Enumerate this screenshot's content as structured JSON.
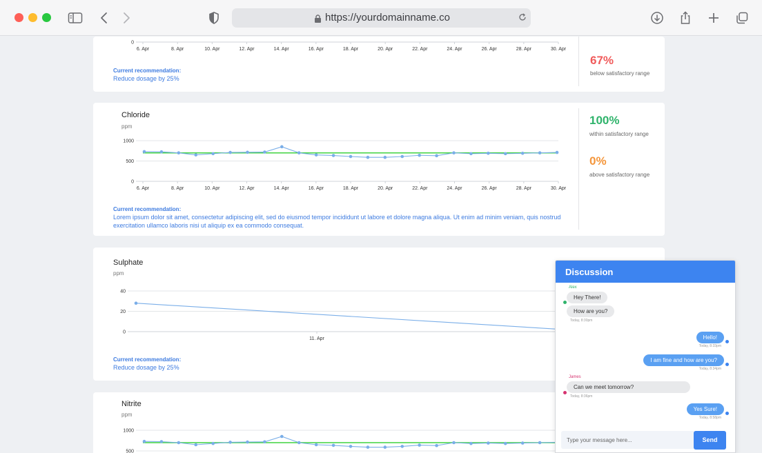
{
  "browser": {
    "url": "https://yourdomainname.co"
  },
  "charts": [
    {
      "id": "top",
      "title": "",
      "unit": "",
      "recommendation_label": "Current recommendation:",
      "recommendation": "Reduce dosage by 25%",
      "stats": [
        {
          "value": "67%",
          "label": "below satisfactory range",
          "color": "#f05a5a"
        }
      ]
    },
    {
      "id": "chloride",
      "title": "Chloride",
      "unit": "ppm",
      "recommendation_label": "Current recommendation:",
      "recommendation": "Lorem ipsum dolor sit amet, consectetur adipiscing elit, sed do eiusmod tempor incididunt ut labore et dolore magna aliqua. Ut enim ad minim veniam, quis nostrud exercitation ullamco laboris nisi ut aliquip ex ea commodo consequat.",
      "stats": [
        {
          "value": "100%",
          "label": "within satisfactory range",
          "color": "#2fb36b"
        },
        {
          "value": "0%",
          "label": "above satisfactory range",
          "color": "#f4963b"
        }
      ]
    },
    {
      "id": "sulphate",
      "title": "Sulphate",
      "unit": "ppm",
      "recommendation_label": "Current recommendation:",
      "recommendation": "Reduce dosage by 25%",
      "stats": []
    },
    {
      "id": "nitrite",
      "title": "Nitrite",
      "unit": "ppm",
      "recommendation_label": "",
      "recommendation": "",
      "stats": []
    }
  ],
  "chart_data": [
    {
      "type": "line",
      "x_ticks": [
        "6. Apr",
        "8. Apr",
        "10. Apr",
        "12. Apr",
        "14. Apr",
        "16. Apr",
        "18. Apr",
        "20. Apr",
        "22. Apr",
        "24. Apr",
        "26. Apr",
        "28. Apr",
        "30. Apr"
      ],
      "y_ticks": [
        "0"
      ]
    },
    {
      "type": "line",
      "x_ticks": [
        "6. Apr",
        "8. Apr",
        "10. Apr",
        "12. Apr",
        "14. Apr",
        "16. Apr",
        "18. Apr",
        "20. Apr",
        "22. Apr",
        "24. Apr",
        "26. Apr",
        "28. Apr",
        "30. Apr"
      ],
      "y_ticks": [
        "0",
        "500",
        "1000"
      ],
      "ylim": [
        0,
        1000
      ],
      "threshold": 700,
      "values": [
        730,
        725,
        700,
        650,
        680,
        710,
        715,
        720,
        850,
        700,
        650,
        635,
        610,
        590,
        590,
        610,
        640,
        630,
        700,
        680,
        690,
        680,
        690,
        700,
        710
      ],
      "colors": {
        "series": "#7aaee8",
        "threshold": "#3fd33f"
      }
    },
    {
      "type": "line",
      "x_ticks": [
        "11. Apr"
      ],
      "y_ticks": [
        "0",
        "20",
        "40"
      ],
      "ylim": [
        0,
        40
      ],
      "values": [
        28,
        2
      ],
      "colors": {
        "series": "#7aaee8"
      }
    },
    {
      "type": "line",
      "x_ticks": [],
      "y_ticks": [
        "500",
        "1000"
      ],
      "ylim": [
        0,
        1000
      ],
      "threshold": 700,
      "values": [
        730,
        725,
        700,
        650,
        680,
        710,
        715,
        720,
        850,
        700,
        650,
        635,
        610,
        590,
        590,
        610,
        640,
        630,
        700,
        680,
        690,
        680,
        690,
        700,
        710
      ],
      "colors": {
        "series": "#7aaee8",
        "threshold": "#3fd33f"
      }
    }
  ],
  "chat": {
    "title": "Discussion",
    "input_placeholder": "Type your message here...",
    "send_label": "Send",
    "messages": [
      {
        "sender": "Alex",
        "text": "Hey There!",
        "side": "in"
      },
      {
        "sender": "",
        "text": "How are you?",
        "side": "in",
        "time": "Today, 8:30pm"
      },
      {
        "sender": "",
        "text": "Hello!",
        "side": "out",
        "time": "Today, 8:33pm"
      },
      {
        "sender": "",
        "text": "I am fine and how are you?",
        "side": "out",
        "time": "Today, 8:34pm"
      },
      {
        "sender": "James",
        "text": "Can we meet tomorrow?",
        "side": "in",
        "time": "Today, 8:36pm"
      },
      {
        "sender": "",
        "text": "Yes Sure!",
        "side": "out",
        "time": "Today, 8:58pm"
      }
    ]
  }
}
